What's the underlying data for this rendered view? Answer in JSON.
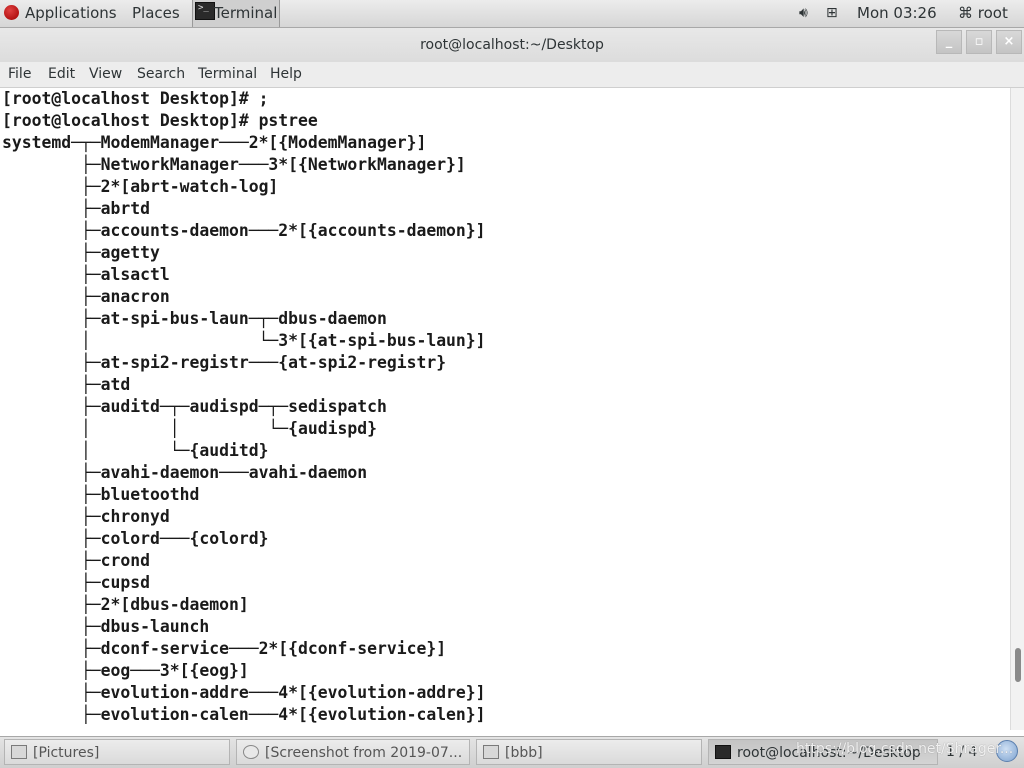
{
  "top_panel": {
    "applications_label": "Applications",
    "places_label": "Places",
    "active_app_label": "Terminal",
    "clock": "Mon 03:26",
    "user": "root",
    "icons": [
      "redhat-logo",
      "volume-icon",
      "network-icon",
      "user-icon"
    ]
  },
  "window": {
    "title": "root@localhost:~/Desktop",
    "buttons": {
      "minimize": "_",
      "maximize": "▫",
      "close": "×"
    }
  },
  "menubar": {
    "items": [
      "File",
      "Edit",
      "View",
      "Search",
      "Terminal",
      "Help"
    ]
  },
  "terminal": {
    "lines": [
      "[root@localhost Desktop]# ;",
      "[root@localhost Desktop]# pstree",
      "systemd─┬─ModemManager───2*[{ModemManager}]",
      "        ├─NetworkManager───3*[{NetworkManager}]",
      "        ├─2*[abrt-watch-log]",
      "        ├─abrtd",
      "        ├─accounts-daemon───2*[{accounts-daemon}]",
      "        ├─agetty",
      "        ├─alsactl",
      "        ├─anacron",
      "        ├─at-spi-bus-laun─┬─dbus-daemon",
      "        │                 └─3*[{at-spi-bus-laun}]",
      "        ├─at-spi2-registr───{at-spi2-registr}",
      "        ├─atd",
      "        ├─auditd─┬─audispd─┬─sedispatch",
      "        │        │         └─{audispd}",
      "        │        └─{auditd}",
      "        ├─avahi-daemon───avahi-daemon",
      "        ├─bluetoothd",
      "        ├─chronyd",
      "        ├─colord───{colord}",
      "        ├─crond",
      "        ├─cupsd",
      "        ├─2*[dbus-daemon]",
      "        ├─dbus-launch",
      "        ├─dconf-service───2*[{dconf-service}]",
      "        ├─eog───3*[{eog}]",
      "        ├─evolution-addre───4*[{evolution-addre}]",
      "        ├─evolution-calen───4*[{evolution-calen}]"
    ]
  },
  "taskbar": {
    "tasks": [
      {
        "label": "[Pictures]",
        "icon": "folder-icon"
      },
      {
        "label": "[Screenshot from 2019-07...",
        "icon": "screenshot-icon"
      },
      {
        "label": "[bbb]",
        "icon": "folder-icon"
      },
      {
        "label": "root@localhost:~/Desktop",
        "icon": "terminal-icon"
      }
    ],
    "workspace": "1 / 4",
    "watermark": "https://blog.csdn.net/Shrager..."
  }
}
